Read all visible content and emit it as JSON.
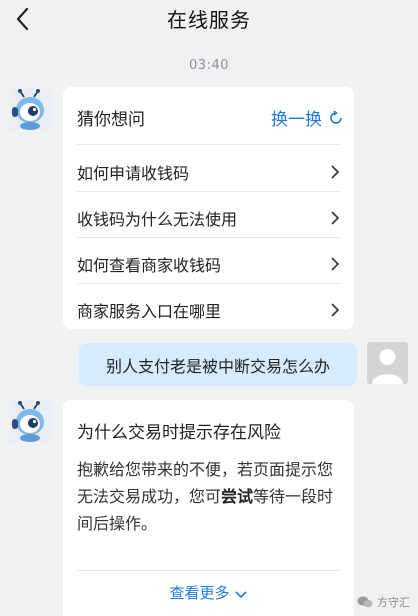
{
  "header": {
    "title": "在线服务"
  },
  "timestamp": "03:40",
  "guess_card": {
    "title": "猜你想问",
    "refresh_label": "换一换",
    "questions": [
      "如何申请收钱码",
      "收钱码为什么无法使用",
      "如何查看商家收钱码",
      "商家服务入口在哪里"
    ]
  },
  "user_message": "别人支付老是被中断交易怎么办",
  "answer_card": {
    "title": "为什么交易时提示存在风险",
    "body_before": "抱歉给您带来的不便，若页面提示您无法交易成功，您可",
    "body_bold": "尝试",
    "body_after": "等待一段时间后操作。",
    "more_label": "查看更多"
  },
  "watermark": "方守汇",
  "colors": {
    "accent": "#1d7be0",
    "user_bubble": "#d6ecfe",
    "background": "#f0f1f3"
  }
}
